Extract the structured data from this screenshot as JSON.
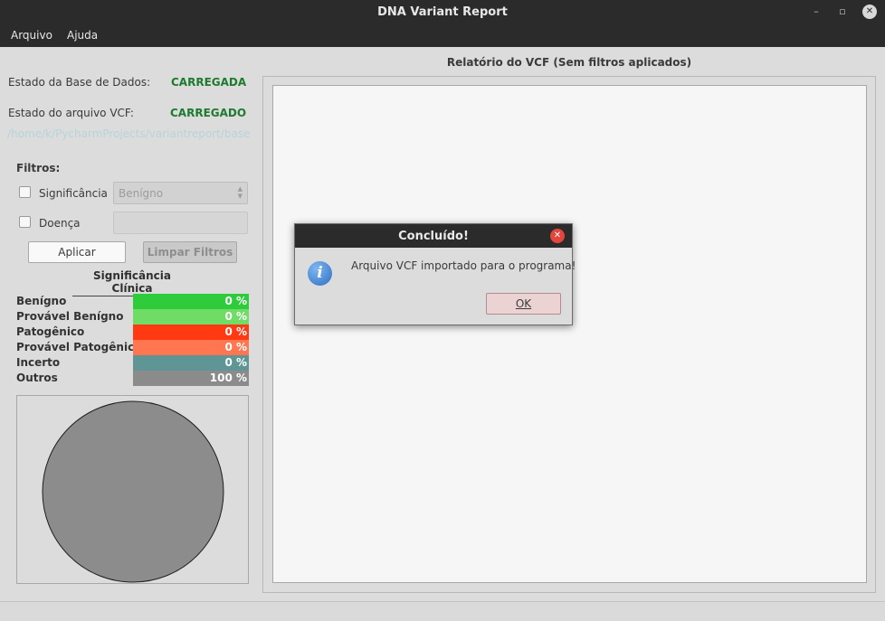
{
  "window": {
    "title": "DNA Variant Report",
    "controls": {
      "minimize": "–",
      "restore": "▫",
      "close": "✕"
    }
  },
  "menu": {
    "items": [
      "Arquivo",
      "Ajuda"
    ]
  },
  "left": {
    "db_status_label": "Estado da Base de Dados:",
    "db_status_value": "CARREGADA",
    "vcf_status_label": "Estado do arquivo VCF:",
    "vcf_status_value": "CARREGADO",
    "vcf_path": "/home/k/PycharmProjects/variantreport/base",
    "filters_title": "Filtros:",
    "filter_significance_label": "Significância",
    "filter_significance_value": "Benígno",
    "filter_disease_label": "Doença",
    "filter_disease_value": "",
    "apply_button": "Aplicar",
    "clear_button": "Limpar Filtros",
    "stats_title": "Significância Clínica",
    "stats": [
      {
        "label": "Benígno",
        "value": "0 %",
        "color": "#2ecc3a"
      },
      {
        "label": "Provável Benígno",
        "value": "0 %",
        "color": "#6fdc66"
      },
      {
        "label": "Patogênico",
        "value": "0 %",
        "color": "#ff3a12"
      },
      {
        "label": "Provável Patogênico",
        "value": "0 %",
        "color": "#ff7650"
      },
      {
        "label": "Incerto",
        "value": "0 %",
        "color": "#5f9595"
      },
      {
        "label": "Outros",
        "value": "100 %",
        "color": "#8b8b8b"
      }
    ],
    "pie_color": "#8c8c8c"
  },
  "report": {
    "title": "Relatório do VCF (Sem filtros aplicados)"
  },
  "dialog": {
    "title": "Concluído!",
    "message": "Arquivo VCF importado para o programa!",
    "ok_button": "OK",
    "icon": "info-icon"
  }
}
